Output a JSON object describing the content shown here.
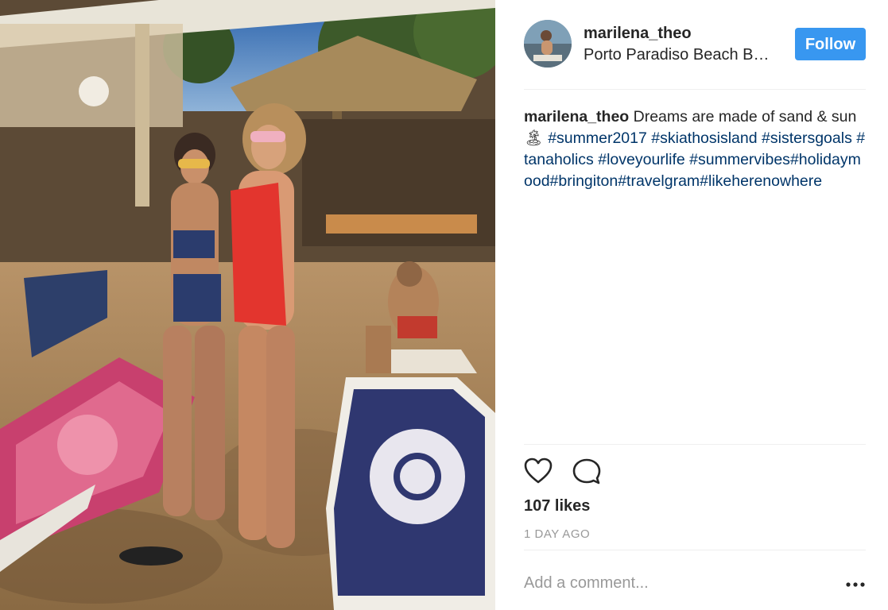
{
  "post": {
    "username": "marilena_theo",
    "location": "Porto Paradiso Beach B…",
    "follow_label": "Follow",
    "caption": {
      "username": "marilena_theo",
      "text": "Dreams are made of sand & sun 🏝 ",
      "hashtags": [
        "#summer2017",
        "#skiathosisland",
        "#sistersgoals",
        "#tanaholics",
        "#loveyourlife",
        "#summervibes",
        "#holidaymood",
        "#bringiton",
        "#travelgram",
        "#likeherenowhere"
      ]
    },
    "likes": "107 likes",
    "time_ago": "1 DAY AGO",
    "comment_placeholder": "Add a comment..."
  },
  "icons": {
    "like": "heart-icon",
    "comment": "comment-bubble-icon",
    "more": "more-options-icon"
  },
  "colors": {
    "follow_button": "#3897f0",
    "hashtag": "#003569",
    "muted_text": "#999999",
    "divider": "#efefef"
  }
}
